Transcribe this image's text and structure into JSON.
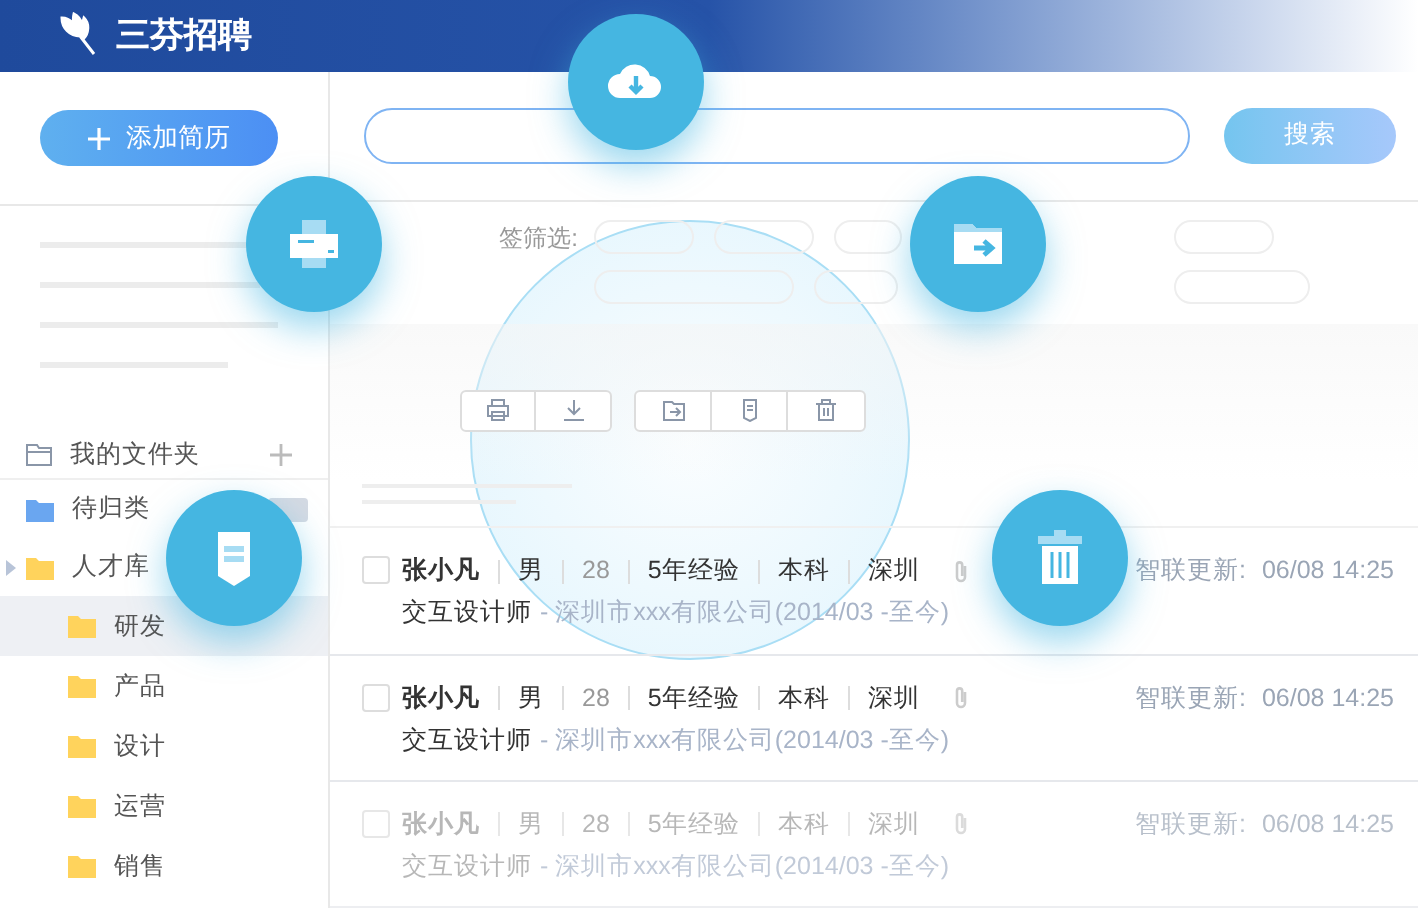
{
  "app": {
    "title": "三芬招聘"
  },
  "sidebar": {
    "add_button": "添加简历",
    "folders_header": "我的文件夹",
    "folders": [
      {
        "label": "待归类",
        "kind": "inbox",
        "selected": false
      },
      {
        "label": "人才库",
        "kind": "group",
        "selected": false,
        "expanded": true,
        "children": [
          {
            "label": "研发",
            "selected": true
          },
          {
            "label": "产品",
            "selected": false
          },
          {
            "label": "设计",
            "selected": false
          },
          {
            "label": "运营",
            "selected": false
          },
          {
            "label": "销售",
            "selected": false
          }
        ]
      }
    ]
  },
  "search": {
    "button": "搜索"
  },
  "filter": {
    "label": "签筛选:"
  },
  "candidates": [
    {
      "name": "张小凡",
      "gender": "男",
      "age": "28",
      "experience": "5年经验",
      "education": "本科",
      "city": "深圳",
      "title": "交互设计师",
      "company": "- 深圳市xxx有限公司(2014/03 -至今)",
      "update_label": "智联更新:",
      "updated": "06/08 14:25",
      "dimmed": false,
      "checked": false
    },
    {
      "name": "张小凡",
      "gender": "男",
      "age": "28",
      "experience": "5年经验",
      "education": "本科",
      "city": "深圳",
      "title": "交互设计师",
      "company": "- 深圳市xxx有限公司(2014/03 -至今)",
      "update_label": "智联更新:",
      "updated": "06/08 14:25",
      "dimmed": false,
      "checked": false
    },
    {
      "name": "张小凡",
      "gender": "男",
      "age": "28",
      "experience": "5年经验",
      "education": "本科",
      "city": "深圳",
      "title": "交互设计师",
      "company": "- 深圳市xxx有限公司(2014/03 -至今)",
      "update_label": "智联更新:",
      "updated": "06/08 14:25",
      "dimmed": true,
      "checked": false
    }
  ]
}
